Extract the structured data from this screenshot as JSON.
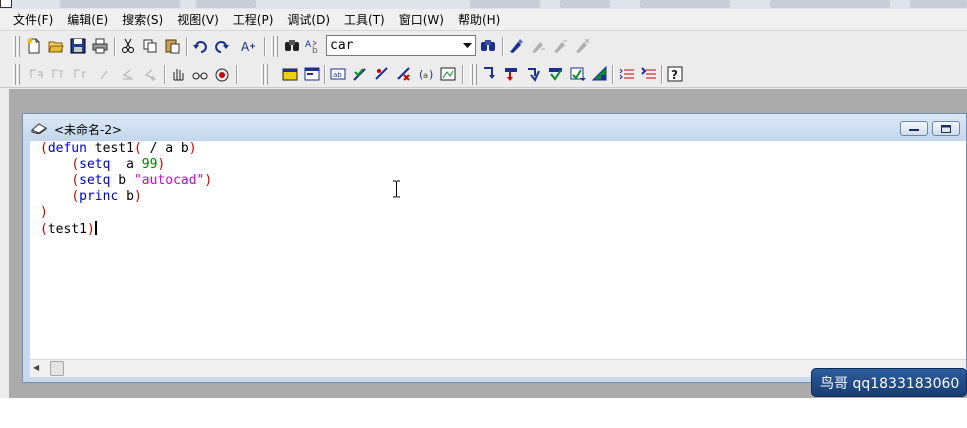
{
  "menu": {
    "items": [
      "文件(F)",
      "编辑(E)",
      "搜索(S)",
      "视图(V)",
      "工程(P)",
      "调试(D)",
      "工具(T)",
      "窗口(W)",
      "帮助(H)"
    ]
  },
  "toolbar": {
    "search_value": "car",
    "icons_row1": [
      "new-file-icon",
      "open-folder-icon",
      "save-icon",
      "print-icon",
      "cut-icon",
      "copy-icon",
      "paste-icon",
      "undo-icon",
      "redo-icon",
      "complete-word-icon",
      "find-icon",
      "replace-icon",
      "find-toolbar-icon",
      "toggle-bookmark-icon",
      "next-bookmark-icon",
      "previous-bookmark-icon",
      "clear-bookmarks-icon"
    ],
    "icons_row2": [
      "indent-block-icon",
      "unindent-block-icon",
      "prefix-icon",
      "comment-block-icon",
      "uncomment-block-icon",
      "uncomment-alt-icon",
      "hand-icon",
      "watch-glasses-icon",
      "record-icon",
      "load-active-window-icon",
      "load-selection-icon",
      "format-window-icon",
      "check-text-icon",
      "apropos-icon",
      "parentheses-match-icon",
      "inspect-icon",
      "step-into-icon",
      "step-over-icon",
      "step-out-icon",
      "continue-icon",
      "quit-icon",
      "reset-icon",
      "toggle-breakpoint-icon",
      "clear-breakpoints-icon",
      "help-icon"
    ]
  },
  "editor": {
    "title": "<未命名-2>",
    "lines": [
      [
        {
          "t": "(",
          "c": "paren"
        },
        {
          "t": "defun",
          "c": "kw"
        },
        {
          "t": " test1",
          "c": "ident"
        },
        {
          "t": "(",
          "c": "paren"
        },
        {
          "t": " / a b",
          "c": "ident"
        },
        {
          "t": ")",
          "c": "paren"
        }
      ],
      [
        {
          "t": "    ",
          "c": "ident"
        },
        {
          "t": "(",
          "c": "paren"
        },
        {
          "t": "setq",
          "c": "kw"
        },
        {
          "t": "  a ",
          "c": "ident"
        },
        {
          "t": "99",
          "c": "num"
        },
        {
          "t": ")",
          "c": "paren"
        }
      ],
      [
        {
          "t": "    ",
          "c": "ident"
        },
        {
          "t": "(",
          "c": "paren"
        },
        {
          "t": "setq",
          "c": "kw"
        },
        {
          "t": " b ",
          "c": "ident"
        },
        {
          "t": "\"autocad\"",
          "c": "str"
        },
        {
          "t": ")",
          "c": "paren"
        }
      ],
      [
        {
          "t": "    ",
          "c": "ident"
        },
        {
          "t": "(",
          "c": "paren"
        },
        {
          "t": "princ",
          "c": "kw"
        },
        {
          "t": " b",
          "c": "ident"
        },
        {
          "t": ")",
          "c": "paren"
        }
      ],
      [
        {
          "t": ")",
          "c": "paren"
        }
      ],
      [
        {
          "t": "(",
          "c": "paren"
        },
        {
          "t": "test1",
          "c": "ident"
        },
        {
          "t": ")",
          "c": "paren"
        }
      ]
    ]
  },
  "watermark": {
    "text": "鸟哥 qq1833183060"
  },
  "colors": {
    "paren": "#d00000",
    "keyword": "#0000c8",
    "number": "#008000",
    "string": "#d000d0"
  }
}
